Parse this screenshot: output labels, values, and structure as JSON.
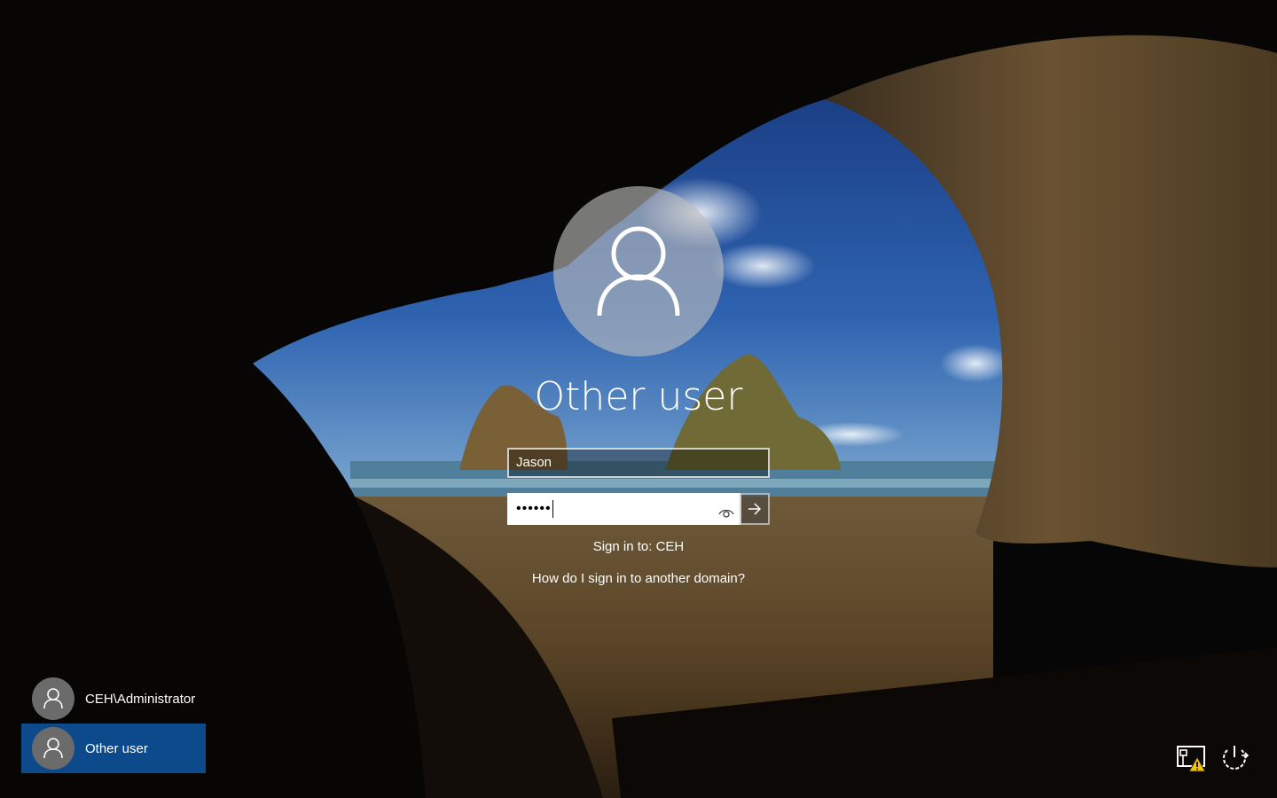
{
  "login": {
    "title": "Other user",
    "username_value": "Jason",
    "password_mask": "••••••",
    "sign_in_to": "Sign in to: CEH",
    "domain_help_link": "How do I sign in to another domain?"
  },
  "user_list": [
    {
      "label": "CEH\\Administrator",
      "selected": false
    },
    {
      "label": "Other user",
      "selected": true
    }
  ],
  "icons": {
    "user_avatar": "person-icon",
    "reveal": "eye-icon",
    "submit": "arrow-right-icon",
    "network": "network-warning-icon",
    "power": "power-icon"
  },
  "colors": {
    "selected_user_bg": "#0c4a8c",
    "avatar_bg": "#6b6b6b"
  }
}
